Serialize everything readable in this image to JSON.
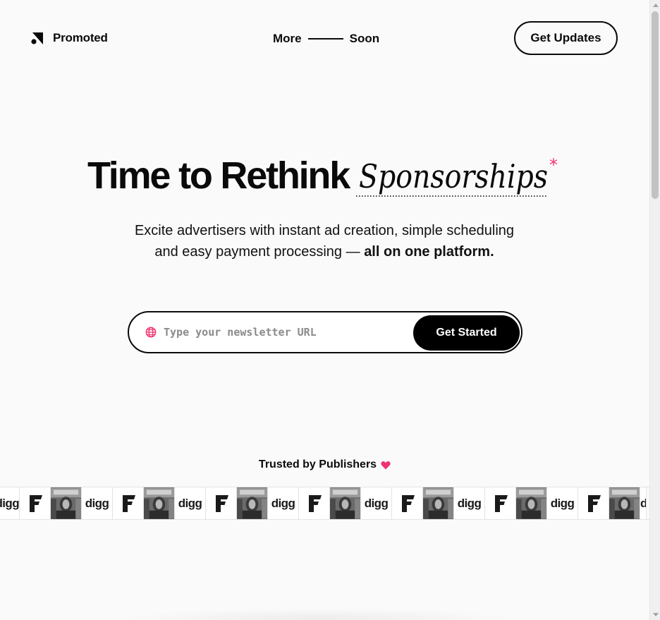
{
  "header": {
    "brand": "Promoted",
    "nav_left": "More",
    "nav_right": "Soon",
    "updates_button": "Get Updates"
  },
  "hero": {
    "title_plain": "Time to Rethink",
    "title_script": "Sponsorships",
    "title_mark": "*",
    "subtitle_line1": "Excite advertisers with instant ad creation, simple scheduling",
    "subtitle_line2": "and easy payment processing —",
    "subtitle_bold": "all on one platform."
  },
  "signup": {
    "placeholder": "Type your newsletter URL",
    "button": "Get Started",
    "icon": "globe-icon"
  },
  "trusted": {
    "label": "Trusted by Publishers",
    "icon": "heart-icon",
    "logos": [
      "digg",
      "F",
      "photo",
      "digg",
      "F",
      "photo",
      "digg",
      "F",
      "photo",
      "digg",
      "F",
      "photo",
      "digg",
      "F",
      "photo",
      "digg",
      "F",
      "photo",
      "digg",
      "F",
      "photo",
      "digg"
    ],
    "digg_text": "digg",
    "f_text": "F"
  },
  "colors": {
    "accent_pink": "#f0336e",
    "ink": "#0a0a0a",
    "background": "#fafafa"
  }
}
